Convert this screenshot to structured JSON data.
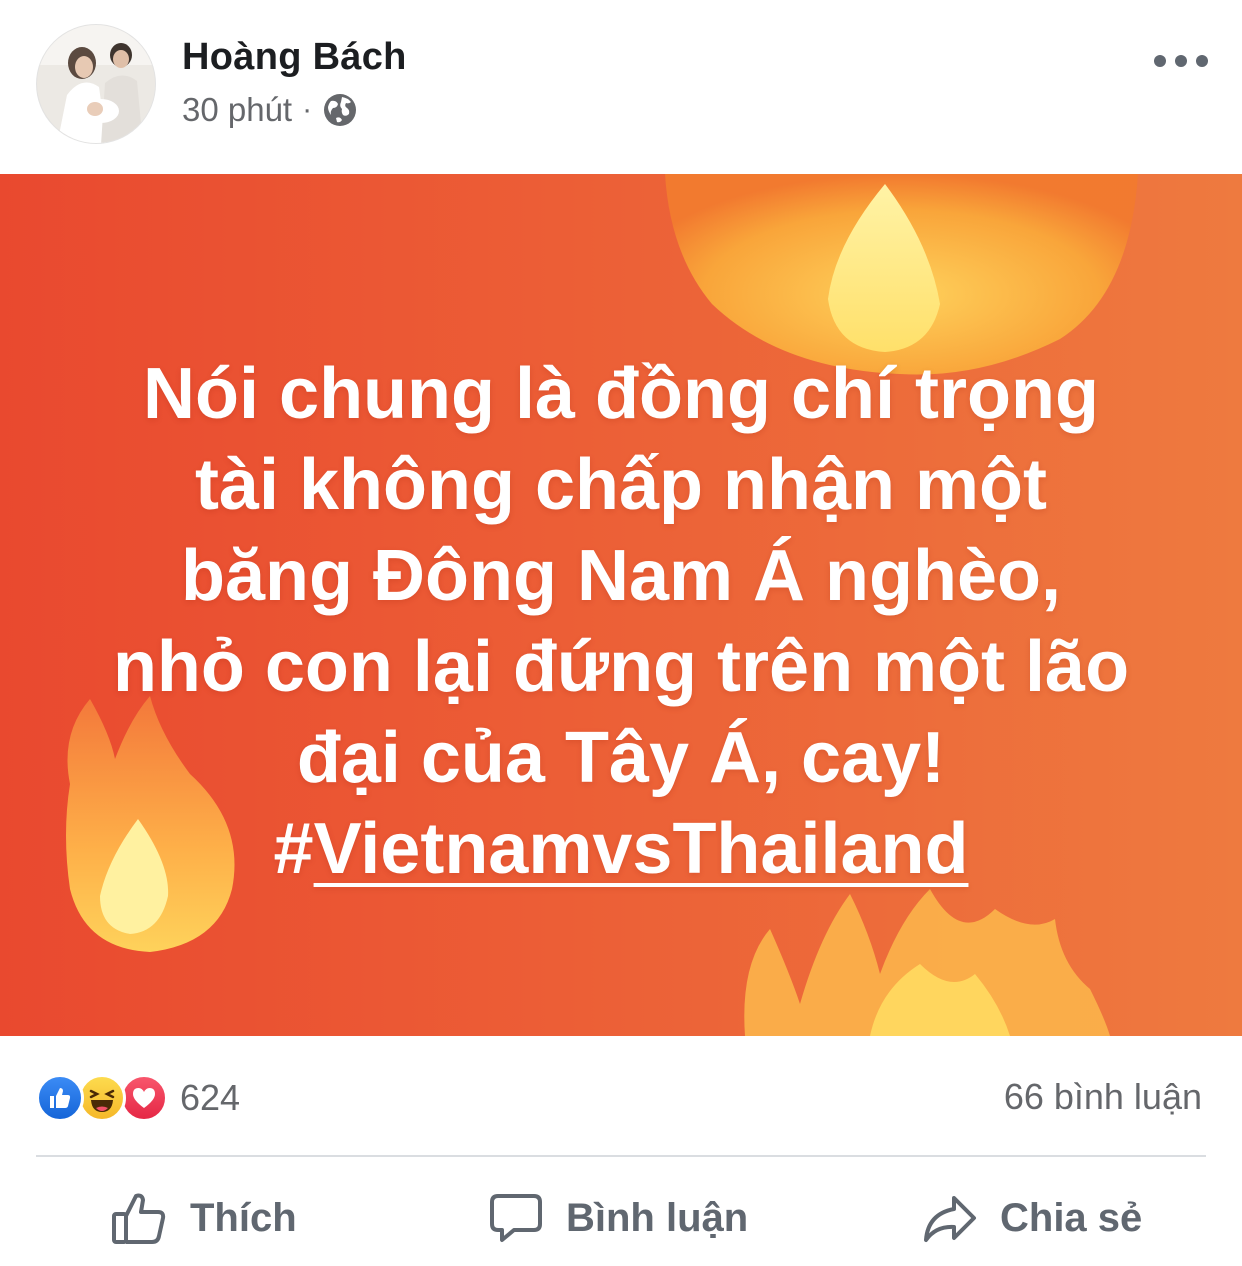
{
  "header": {
    "author_name": "Hoàng Bách",
    "time": "30 phút",
    "separator": "·",
    "privacy_icon": "globe-icon",
    "more_icon": "more-options-icon"
  },
  "post": {
    "lines": [
      "Nói chung là đồng chí trọng",
      "tài không chấp nhận một",
      "băng Đông Nam Á nghèo,",
      "nhỏ con lại đứng trên một lão",
      "đại của Tây Á, cay!"
    ],
    "hashtag_prefix": "#",
    "hashtag": "VietnamvsThailand",
    "background_colors": [
      "#e9492f",
      "#ee7a3f"
    ]
  },
  "stats": {
    "reaction_icons": [
      "like-icon",
      "haha-icon",
      "love-icon"
    ],
    "reaction_count": "624",
    "comment_count": "66 bình luận"
  },
  "actions": {
    "like_label": "Thích",
    "comment_label": "Bình luận",
    "share_label": "Chia sẻ"
  }
}
